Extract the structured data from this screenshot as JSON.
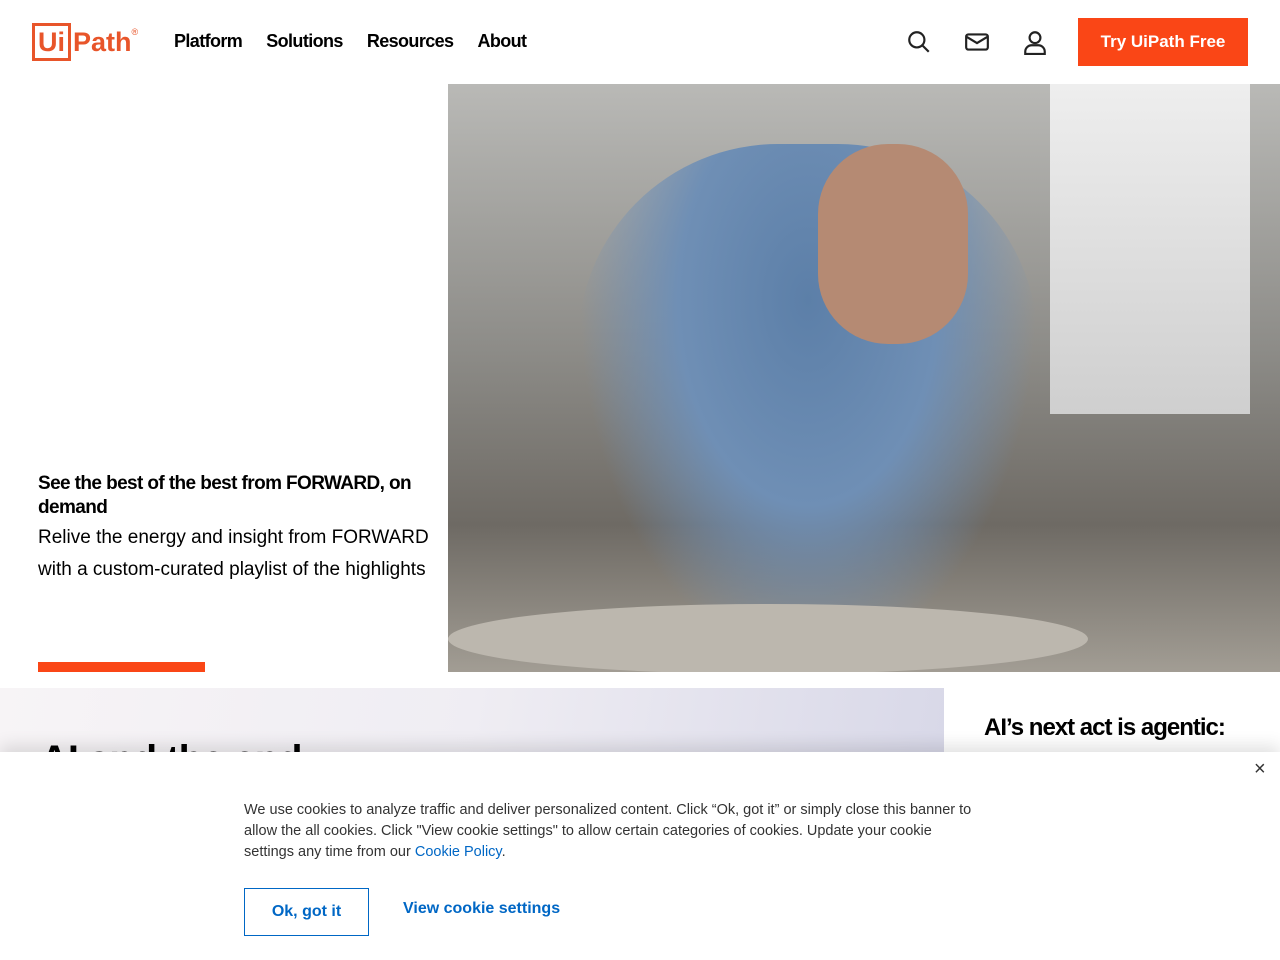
{
  "header": {
    "logo": "UiPath",
    "nav": [
      "Platform",
      "Solutions",
      "Resources",
      "About"
    ],
    "cta": "Try UiPath Free",
    "icons": [
      "search-icon",
      "mail-icon",
      "user-icon"
    ]
  },
  "hero": {
    "title": "See the best of the best from FORWARD, on demand",
    "description": "Relive the energy and insight from FORWARD with a custom-curated playlist of the highlights"
  },
  "section2": {
    "title": "AI and the end",
    "card_title": "AI’s next act is agentic:"
  },
  "cookie": {
    "text": "We use cookies to analyze traffic and deliver personalized content. Click “Ok, got it” or simply close this banner to allow the all cookies. Click \"View cookie settings\" to allow certain categories of cookies. Update your cookie settings any time from our ",
    "link": "Cookie Policy",
    "end": ".",
    "ok": "Ok, got it",
    "settings": "View cookie settings",
    "close": "×"
  },
  "colors": {
    "accent": "#fa4616",
    "link": "#0067c5"
  }
}
